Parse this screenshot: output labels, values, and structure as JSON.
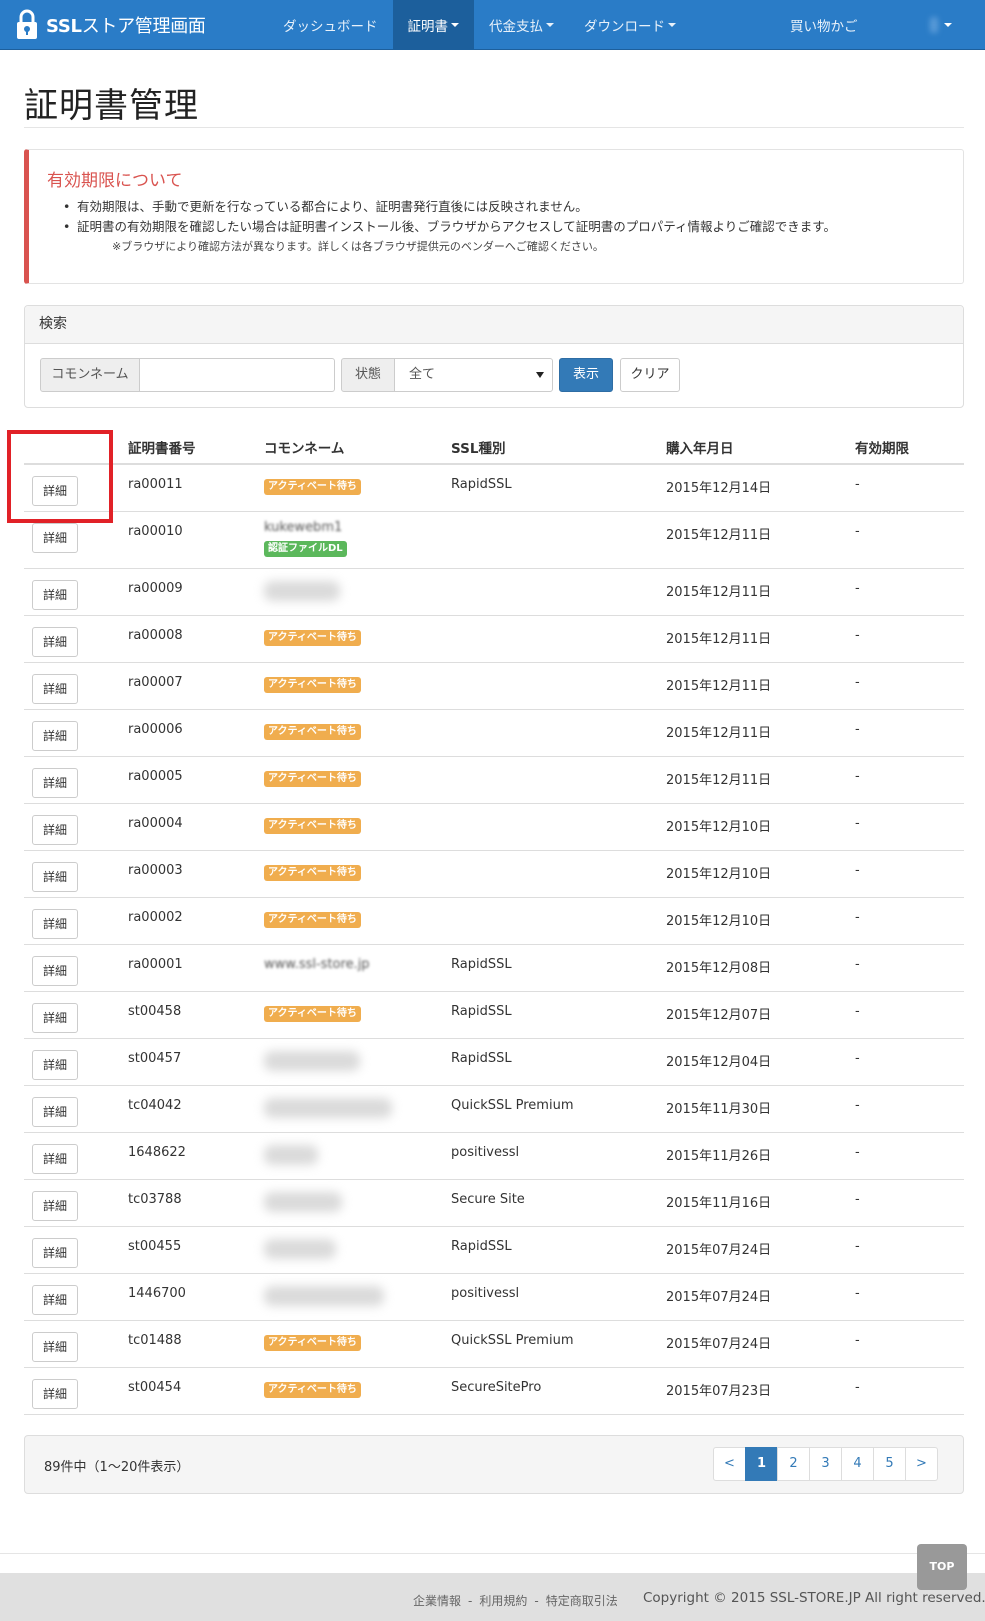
{
  "nav": {
    "brand_bold": "SSL",
    "brand_rest": "ストア管理画面",
    "items": [
      {
        "label": "ダッシュボード",
        "dropdown": false,
        "active": false
      },
      {
        "label": "証明書",
        "dropdown": true,
        "active": true
      },
      {
        "label": "代金支払",
        "dropdown": true,
        "active": false
      },
      {
        "label": "ダウンロード",
        "dropdown": true,
        "active": false
      }
    ],
    "cart": "買い物かご",
    "user_icon": "user-menu-icon"
  },
  "page": {
    "title": "証明書管理"
  },
  "notice": {
    "heading": "有効期限について",
    "items": [
      "有効期限は、手動で更新を行なっている都合により、証明書発行直後には反映されません。",
      "証明書の有効期限を確認したい場合は証明書インストール後、ブラウザからアクセスして証明書のプロパティ情報よりご確認できます。"
    ],
    "note": "※ブラウザにより確認方法が異なります。詳しくは各ブラウザ提供元のベンダーへご確認ください。"
  },
  "search": {
    "heading": "検索",
    "common_name_label": "コモンネーム",
    "common_name_value": "",
    "status_label": "状態",
    "status_selected": "全て",
    "submit": "表示",
    "clear": "クリア"
  },
  "table": {
    "headers": [
      "証明書番号",
      "コモンネーム",
      "SSL種別",
      "購入年月日",
      "有効期限"
    ],
    "detail_label": "詳細",
    "rows": [
      {
        "no": "ra00011",
        "badge": "アクティベート待ち",
        "badge_type": "warn",
        "ssl": "RapidSSL",
        "date": "2015年12月14日",
        "exp": "-"
      },
      {
        "no": "ra00010",
        "cn_partial": "kukewebm1",
        "badge": "認証ファイルDL",
        "badge_type": "ok",
        "ssl": "",
        "date": "2015年12月11日",
        "exp": "-"
      },
      {
        "no": "ra00009",
        "badge": "",
        "badge_type": "",
        "ssl": "",
        "date": "2015年12月11日",
        "exp": "-"
      },
      {
        "no": "ra00008",
        "badge": "アクティベート待ち",
        "badge_type": "warn",
        "ssl": "",
        "date": "2015年12月11日",
        "exp": "-"
      },
      {
        "no": "ra00007",
        "badge": "アクティベート待ち",
        "badge_type": "warn",
        "ssl": "",
        "date": "2015年12月11日",
        "exp": "-"
      },
      {
        "no": "ra00006",
        "badge": "アクティベート待ち",
        "badge_type": "warn",
        "ssl": "",
        "date": "2015年12月11日",
        "exp": "-"
      },
      {
        "no": "ra00005",
        "badge": "アクティベート待ち",
        "badge_type": "warn",
        "ssl": "",
        "date": "2015年12月11日",
        "exp": "-"
      },
      {
        "no": "ra00004",
        "badge": "アクティベート待ち",
        "badge_type": "warn",
        "ssl": "",
        "date": "2015年12月10日",
        "exp": "-"
      },
      {
        "no": "ra00003",
        "badge": "アクティベート待ち",
        "badge_type": "warn",
        "ssl": "",
        "date": "2015年12月10日",
        "exp": "-"
      },
      {
        "no": "ra00002",
        "badge": "アクティベート待ち",
        "badge_type": "warn",
        "ssl": "",
        "date": "2015年12月10日",
        "exp": "-"
      },
      {
        "no": "ra00001",
        "cn_partial": "www.ssl-store.jp",
        "badge": "",
        "badge_type": "",
        "ssl": "RapidSSL",
        "date": "2015年12月08日",
        "exp": "-"
      },
      {
        "no": "st00458",
        "badge": "アクティベート待ち",
        "badge_type": "warn",
        "ssl": "RapidSSL",
        "date": "2015年12月07日",
        "exp": "-"
      },
      {
        "no": "st00457",
        "badge": "",
        "badge_type": "",
        "ssl": "RapidSSL",
        "date": "2015年12月04日",
        "exp": "-"
      },
      {
        "no": "tc04042",
        "badge": "",
        "badge_type": "",
        "ssl": "QuickSSL Premium",
        "date": "2015年11月30日",
        "exp": "-"
      },
      {
        "no": "1648622",
        "badge": "",
        "badge_type": "",
        "ssl": "positivessl",
        "date": "2015年11月26日",
        "exp": "-"
      },
      {
        "no": "tc03788",
        "badge": "",
        "badge_type": "",
        "ssl": "Secure Site",
        "date": "2015年11月16日",
        "exp": "-"
      },
      {
        "no": "st00455",
        "badge": "",
        "badge_type": "",
        "ssl": "RapidSSL",
        "date": "2015年07月24日",
        "exp": "-"
      },
      {
        "no": "1446700",
        "badge": "",
        "badge_type": "",
        "ssl": "positivessl",
        "date": "2015年07月24日",
        "exp": "-"
      },
      {
        "no": "tc01488",
        "badge": "アクティベート待ち",
        "badge_type": "warn",
        "ssl": "QuickSSL Premium",
        "date": "2015年07月24日",
        "exp": "-"
      },
      {
        "no": "st00454",
        "badge": "アクティベート待ち",
        "badge_type": "warn",
        "ssl": "SecureSitePro",
        "date": "2015年07月23日",
        "exp": "-"
      }
    ]
  },
  "pagination": {
    "summary": "89件中（1〜20件表示）",
    "prev": "<",
    "next": ">",
    "pages": [
      "1",
      "2",
      "3",
      "4",
      "5"
    ],
    "current": "1"
  },
  "footer": {
    "links": [
      "企業情報",
      "利用規約",
      "特定商取引法"
    ],
    "copyright": "Copyright © 2015 SSL-STORE.JP All right reserved.",
    "top_button": "TOP"
  },
  "colors": {
    "navbar": "#2a7cc7",
    "primary": "#337ab7",
    "danger": "#d9534f",
    "warning_badge": "#f0ad4e",
    "success_badge": "#5cb85c",
    "highlight": "#e12127"
  }
}
